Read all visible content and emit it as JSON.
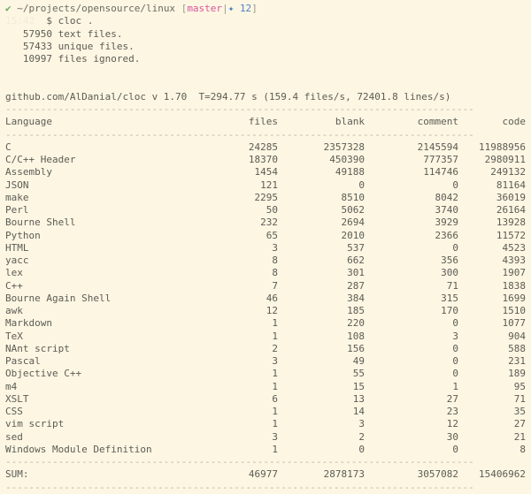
{
  "terminal": {
    "background_color": "#fdf6e3",
    "foreground_color": "#5c5c54",
    "prompt": {
      "status_icon": "check-icon",
      "status_symbol": "✔",
      "status_color": "#6aa84f",
      "path": "~/projects/opensource/linux",
      "git_open_bracket": "[",
      "git_branch": "master",
      "git_branch_color": "#d7559b",
      "git_separator": "|",
      "git_ahead_symbol": "✦",
      "git_ahead_color": "#4a7fc1",
      "git_ahead_count": "12",
      "git_close_bracket": "]",
      "timestamp_faint": "15:42",
      "dollar": "$",
      "command": "cloc ."
    },
    "output_lines": [
      "   57950 text files.",
      "   57433 unique files.",
      "   10997 files ignored."
    ],
    "summary_line": "github.com/AlDanial/cloc v 1.70  T=294.77 s (159.4 files/s, 72401.8 lines/s)",
    "summary_parts": {
      "url": "github.com/AlDanial/cloc",
      "version_label": "v",
      "version": "1.70",
      "time_label": "T=",
      "time_value": "294.77",
      "time_unit": "s",
      "files_rate": "159.4 files/s",
      "lines_rate": "72401.8 lines/s"
    },
    "rule_char": "-",
    "rule_width_chars": 80,
    "sum_label": "SUM:"
  },
  "table": {
    "columns": [
      "Language",
      "files",
      "blank",
      "comment",
      "code"
    ],
    "rows": [
      {
        "language": "C",
        "files": "24285",
        "blank": "2357328",
        "comment": "2145594",
        "code": "11988956"
      },
      {
        "language": "C/C++ Header",
        "files": "18370",
        "blank": "450390",
        "comment": "777357",
        "code": "2980911"
      },
      {
        "language": "Assembly",
        "files": "1454",
        "blank": "49188",
        "comment": "114746",
        "code": "249132"
      },
      {
        "language": "JSON",
        "files": "121",
        "blank": "0",
        "comment": "0",
        "code": "81164"
      },
      {
        "language": "make",
        "files": "2295",
        "blank": "8510",
        "comment": "8042",
        "code": "36019"
      },
      {
        "language": "Perl",
        "files": "50",
        "blank": "5062",
        "comment": "3740",
        "code": "26164"
      },
      {
        "language": "Bourne Shell",
        "files": "232",
        "blank": "2694",
        "comment": "3929",
        "code": "13928"
      },
      {
        "language": "Python",
        "files": "65",
        "blank": "2010",
        "comment": "2366",
        "code": "11572"
      },
      {
        "language": "HTML",
        "files": "3",
        "blank": "537",
        "comment": "0",
        "code": "4523"
      },
      {
        "language": "yacc",
        "files": "8",
        "blank": "662",
        "comment": "356",
        "code": "4393"
      },
      {
        "language": "lex",
        "files": "8",
        "blank": "301",
        "comment": "300",
        "code": "1907"
      },
      {
        "language": "C++",
        "files": "7",
        "blank": "287",
        "comment": "71",
        "code": "1838"
      },
      {
        "language": "Bourne Again Shell",
        "files": "46",
        "blank": "384",
        "comment": "315",
        "code": "1699"
      },
      {
        "language": "awk",
        "files": "12",
        "blank": "185",
        "comment": "170",
        "code": "1510"
      },
      {
        "language": "Markdown",
        "files": "1",
        "blank": "220",
        "comment": "0",
        "code": "1077"
      },
      {
        "language": "TeX",
        "files": "1",
        "blank": "108",
        "comment": "3",
        "code": "904"
      },
      {
        "language": "NAnt script",
        "files": "2",
        "blank": "156",
        "comment": "0",
        "code": "588"
      },
      {
        "language": "Pascal",
        "files": "3",
        "blank": "49",
        "comment": "0",
        "code": "231"
      },
      {
        "language": "Objective C++",
        "files": "1",
        "blank": "55",
        "comment": "0",
        "code": "189"
      },
      {
        "language": "m4",
        "files": "1",
        "blank": "15",
        "comment": "1",
        "code": "95"
      },
      {
        "language": "XSLT",
        "files": "6",
        "blank": "13",
        "comment": "27",
        "code": "71"
      },
      {
        "language": "CSS",
        "files": "1",
        "blank": "14",
        "comment": "23",
        "code": "35"
      },
      {
        "language": "vim script",
        "files": "1",
        "blank": "3",
        "comment": "12",
        "code": "27"
      },
      {
        "language": "sed",
        "files": "3",
        "blank": "2",
        "comment": "30",
        "code": "21"
      },
      {
        "language": "Windows Module Definition",
        "files": "1",
        "blank": "0",
        "comment": "0",
        "code": "8"
      }
    ],
    "sum": {
      "language": "SUM:",
      "files": "46977",
      "blank": "2878173",
      "comment": "3057082",
      "code": "15406962"
    }
  }
}
